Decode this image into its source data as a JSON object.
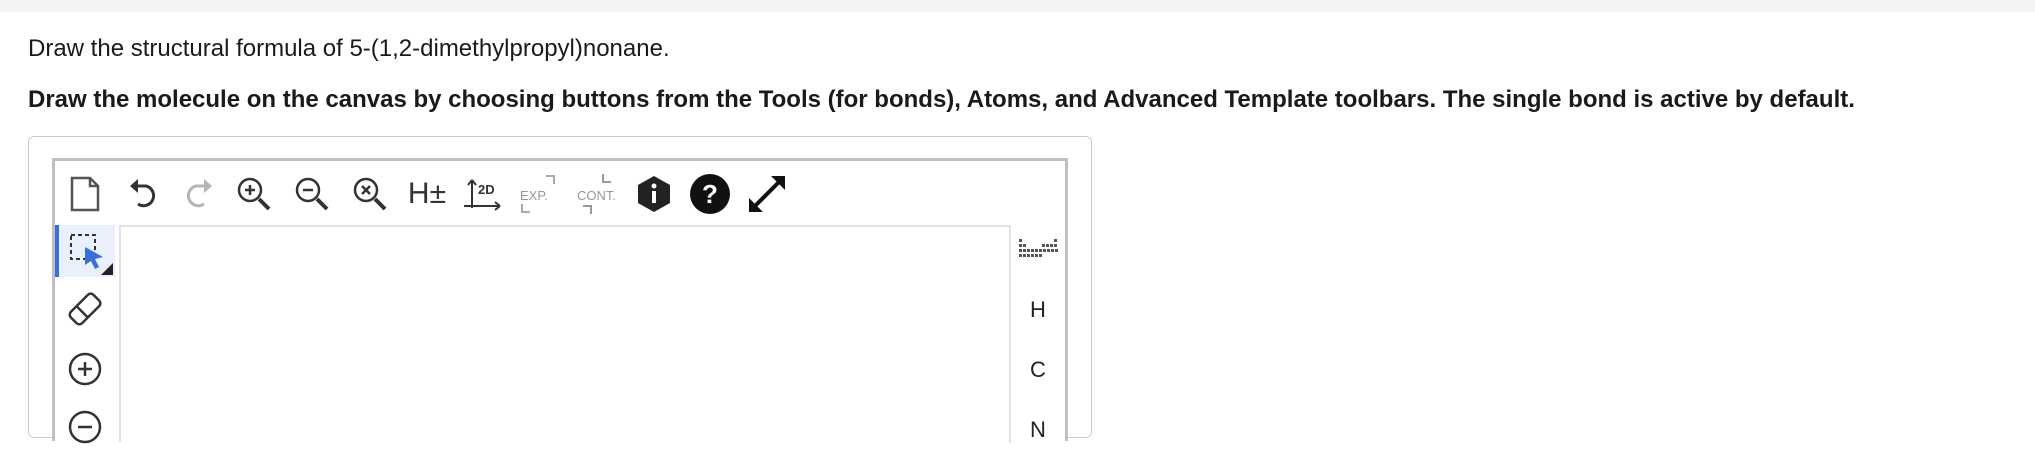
{
  "question": {
    "prompt": "Draw the structural formula of 5-(1,2-dimethylpropyl)nonane.",
    "instructions": "Draw the molecule on the canvas by choosing buttons from the Tools (for bonds), Atoms, and Advanced Template toolbars. The single bond is active by default."
  },
  "toolbar": {
    "h_toggle": "H±",
    "clean2d": "2D",
    "expand": "EXP.",
    "contract": "CONT."
  },
  "atoms": {
    "h": "H",
    "c": "C",
    "n": "N"
  },
  "colors": {
    "active_accent": "#3b6fd8",
    "border": "#bfbfbf"
  },
  "icons": [
    "new-document-icon",
    "undo-icon",
    "redo-icon",
    "zoom-in-icon",
    "zoom-out-icon",
    "zoom-reset-icon",
    "h-toggle-icon",
    "clean-2d-icon",
    "expand-icon",
    "contract-icon",
    "info-icon",
    "help-icon",
    "fullscreen-icon",
    "selection-icon",
    "eraser-icon",
    "charge-plus-icon",
    "periodic-table-icon"
  ]
}
